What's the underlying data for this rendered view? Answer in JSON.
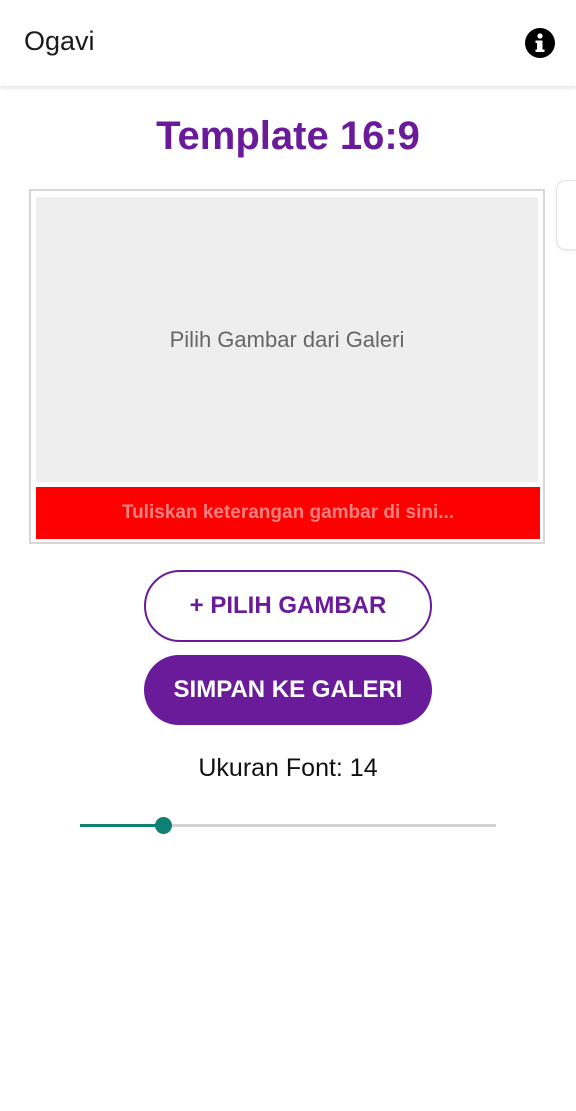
{
  "appbar": {
    "title": "Ogavi",
    "info_icon": "info-circle-icon"
  },
  "page": {
    "title": "Template 16:9"
  },
  "preview": {
    "image_placeholder": "Pilih Gambar dari Galeri",
    "caption_placeholder": "Tuliskan keterangan gambar di sini..."
  },
  "buttons": {
    "pick_image": "+ PILIH GAMBAR",
    "save_to_gallery": "SIMPAN KE GALERI"
  },
  "font_size": {
    "label": "Ukuran Font: 14",
    "slider_fraction": 0.2
  },
  "colors": {
    "accent": "#6a1b9a",
    "caption_bar": "#ff0000",
    "slider": "#0e8074"
  }
}
